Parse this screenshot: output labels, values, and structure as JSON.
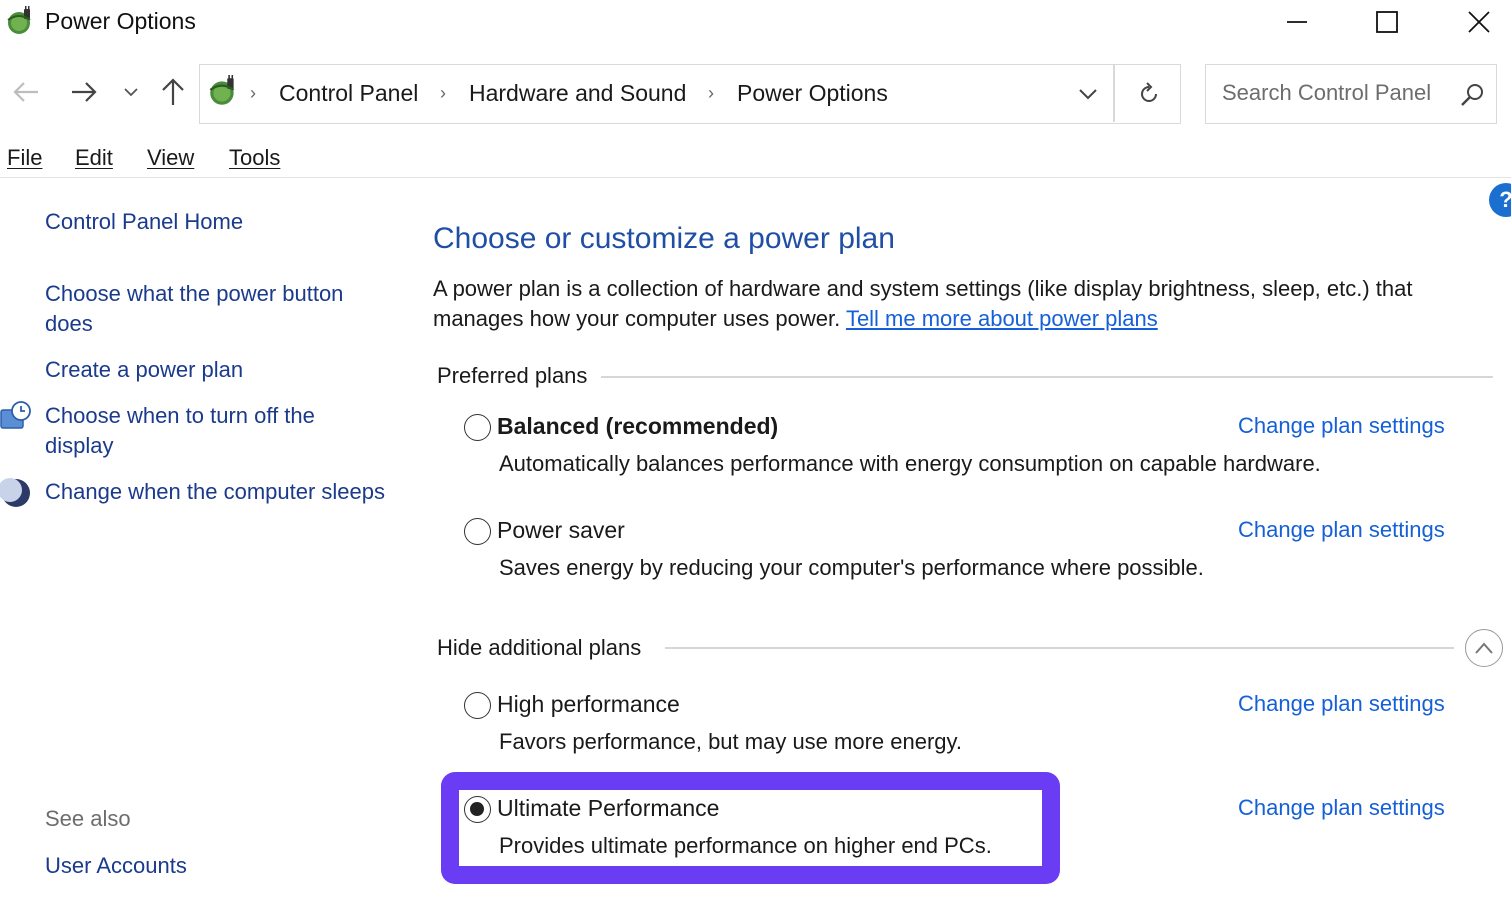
{
  "window": {
    "title": "Power Options",
    "minimize_glyph": "—",
    "app_icon": "power-options-icon"
  },
  "nav": {
    "back_icon": "back-arrow-icon",
    "forward_icon": "forward-arrow-icon",
    "recent_icon": "chevron-down-icon",
    "up_icon": "up-arrow-icon"
  },
  "address": {
    "crumbs": [
      "Control Panel",
      "Hardware and Sound",
      "Power Options"
    ],
    "separator": "›",
    "dropdown_icon": "chevron-down-icon",
    "refresh_icon": "refresh-icon"
  },
  "search": {
    "placeholder": "Search Control Panel",
    "icon": "search-icon"
  },
  "menu": {
    "items": [
      "File",
      "Edit",
      "View",
      "Tools"
    ]
  },
  "help": {
    "glyph": "?"
  },
  "left_pane": {
    "home": "Control Panel Home",
    "links": [
      "Choose what the power button does",
      "Create a power plan",
      "Choose when to turn off the display",
      "Change when the computer sleeps"
    ],
    "see_also_heading": "See also",
    "see_also_links": [
      "User Accounts"
    ]
  },
  "main": {
    "title": "Choose or customize a power plan",
    "intro": "A power plan is a collection of hardware and system settings (like display brightness, sleep, etc.) that manages how your computer uses power.",
    "intro_link": "Tell me more about power plans",
    "preferred_heading": "Preferred plans",
    "additional_heading": "Hide additional plans",
    "change_label": "Change plan settings",
    "plans": [
      {
        "name": "Balanced (recommended)",
        "desc": "Automatically balances performance with energy consumption on capable hardware.",
        "selected": false
      },
      {
        "name": "Power saver",
        "desc": "Saves energy by reducing your computer's performance where possible.",
        "selected": false
      },
      {
        "name": "High performance",
        "desc": "Favors performance, but may use more energy.",
        "selected": false
      },
      {
        "name": "Ultimate Performance",
        "desc": "Provides ultimate performance on higher end PCs.",
        "selected": true
      }
    ]
  },
  "colors": {
    "link": "#1560d8",
    "nav_link": "#1a3a8c",
    "title": "#1f4fa5",
    "highlight": "#6a3df5"
  }
}
